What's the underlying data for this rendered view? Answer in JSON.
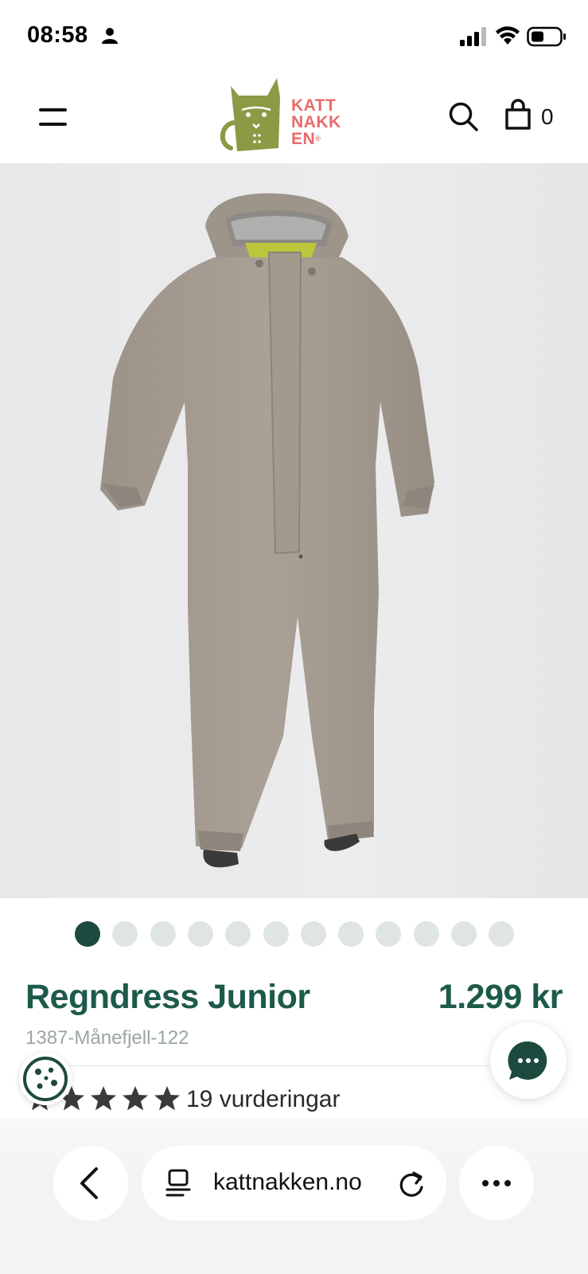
{
  "status_bar": {
    "time": "08:58"
  },
  "header": {
    "logo_lines": [
      "KATT",
      "NAKK",
      "EN"
    ],
    "logo_registered": "®",
    "cart_count": "0"
  },
  "product": {
    "image_description_icon": "rain-suit-image",
    "carousel": {
      "total": 12,
      "active_index": 0
    },
    "title": "Regndress Junior",
    "price": "1.299 kr",
    "sku": "1387-Månefjell-122",
    "rating": {
      "stars": 5,
      "text": "19 vurderingar"
    }
  },
  "browser": {
    "url": "kattnakken.no"
  },
  "colors": {
    "brand_green": "#1c5a4a",
    "active_dot": "#1d4a3e",
    "logo_green": "#8a9a45",
    "logo_pink": "#e96a6a"
  }
}
